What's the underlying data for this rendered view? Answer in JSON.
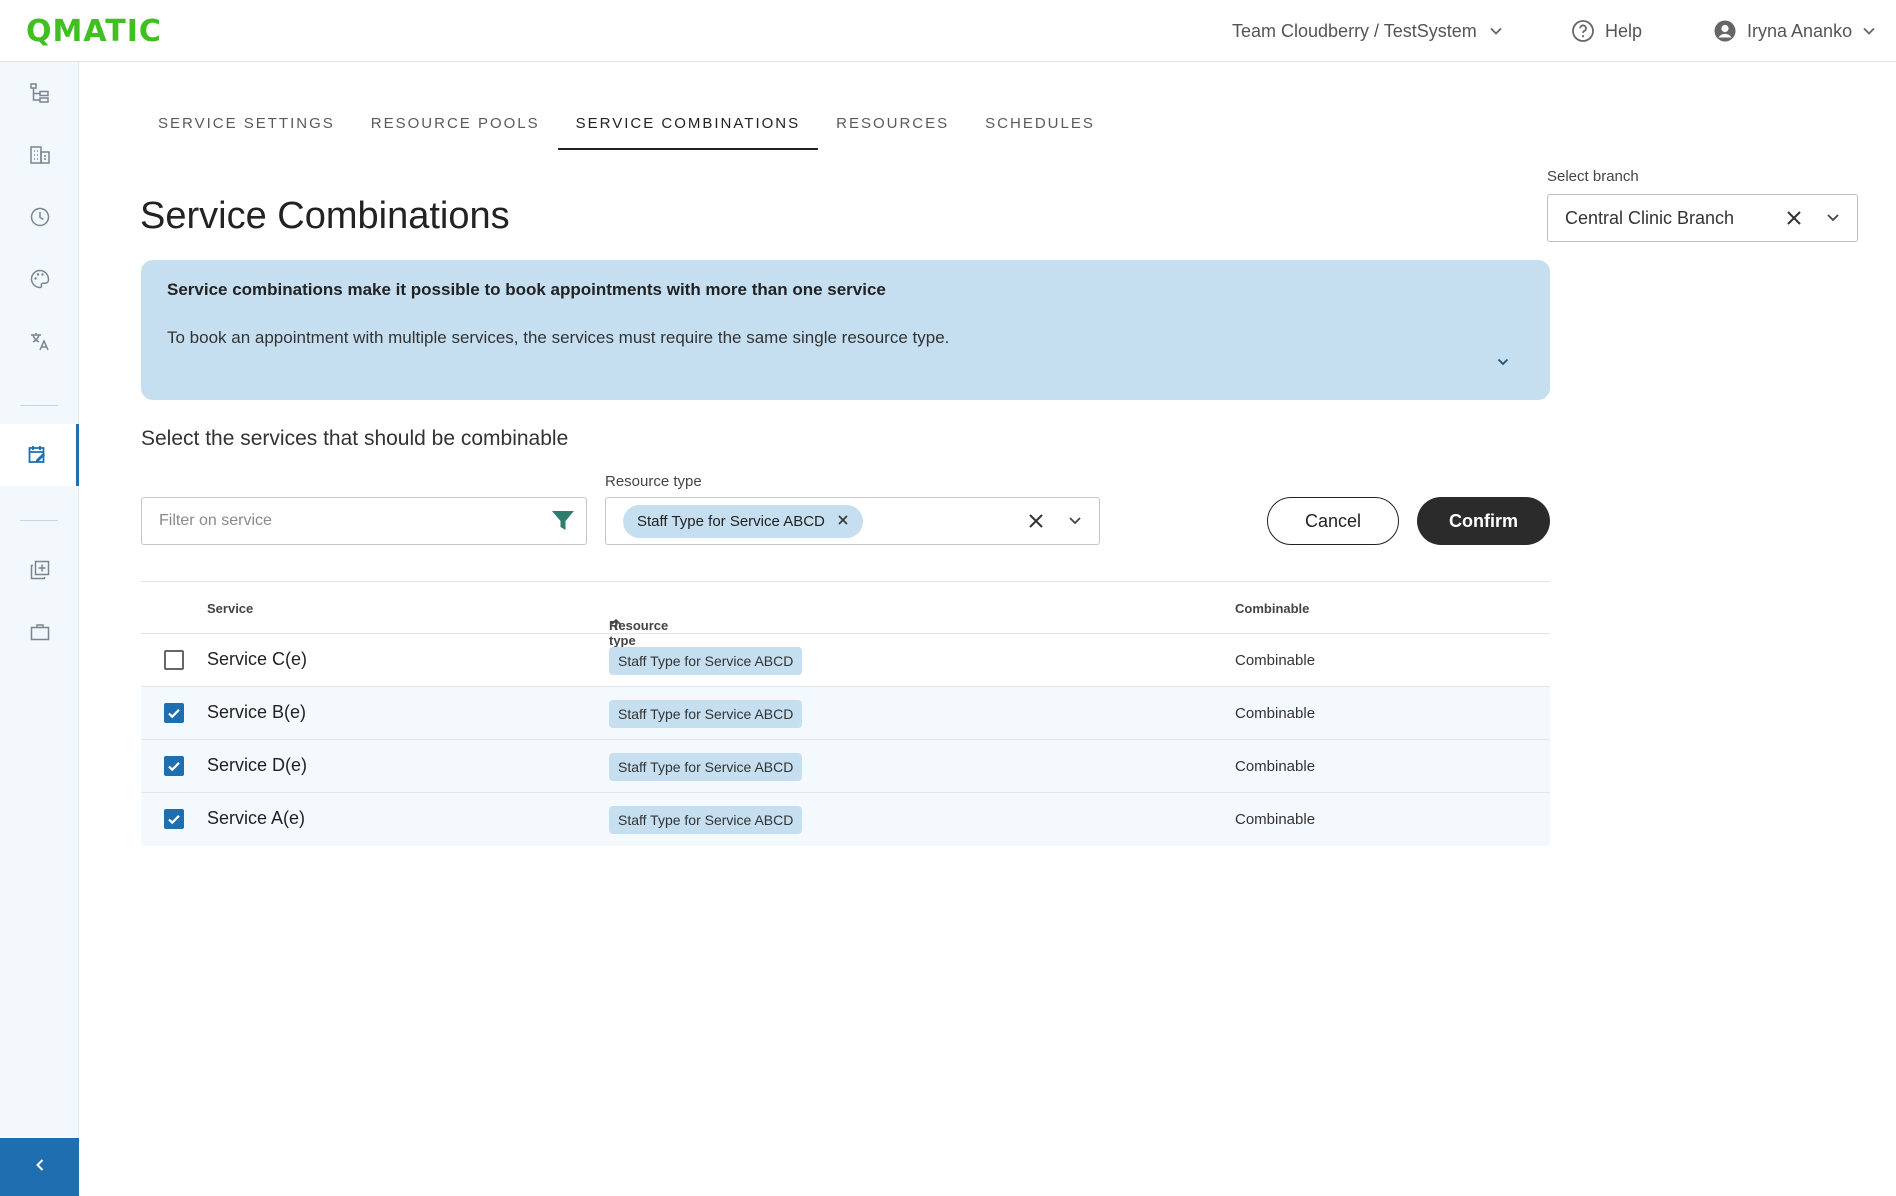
{
  "header": {
    "logo": "QMATIC",
    "team": "Team Cloudberry / TestSystem",
    "help": "Help",
    "user": "Iryna Ananko"
  },
  "sidebar": {
    "icons": [
      "hierarchy-icon",
      "building-icon",
      "clock-icon",
      "palette-icon",
      "translate-icon",
      "calendar-edit-icon",
      "add-copy-icon",
      "briefcase-icon"
    ],
    "active": "calendar-edit-icon"
  },
  "tabs": [
    {
      "label": "SERVICE SETTINGS",
      "active": false
    },
    {
      "label": "RESOURCE POOLS",
      "active": false
    },
    {
      "label": "SERVICE COMBINATIONS",
      "active": true
    },
    {
      "label": "RESOURCES",
      "active": false
    },
    {
      "label": "SCHEDULES",
      "active": false
    }
  ],
  "page": {
    "title": "Service Combinations",
    "branch_label": "Select branch",
    "branch_value": "Central Clinic Branch"
  },
  "info": {
    "title": "Service combinations make it possible to book appointments with more than one service",
    "text": "To book an appointment with multiple services, the services must require the same single resource type."
  },
  "selection": {
    "subtitle": "Select the services that should be combinable",
    "filter_placeholder": "Filter on service",
    "resource_type_label": "Resource type",
    "resource_type_chip": "Staff Type for Service ABCD",
    "cancel": "Cancel",
    "confirm": "Confirm"
  },
  "table": {
    "columns": {
      "service": "Service",
      "resource_type": "Resource type",
      "combinable": "Combinable"
    },
    "rows": [
      {
        "checked": false,
        "service": "Service C(e)",
        "resource_type": "Staff Type for Service ABCD",
        "combinable": "Combinable"
      },
      {
        "checked": true,
        "service": "Service B(e)",
        "resource_type": "Staff Type for Service ABCD",
        "combinable": "Combinable"
      },
      {
        "checked": true,
        "service": "Service D(e)",
        "resource_type": "Staff Type for Service ABCD",
        "combinable": "Combinable"
      },
      {
        "checked": true,
        "service": "Service A(e)",
        "resource_type": "Staff Type for Service ABCD",
        "combinable": "Combinable"
      }
    ]
  },
  "colors": {
    "brand": "#3fbf20",
    "accent": "#1f6fb0",
    "info_bg": "#c6dff0",
    "confirm_bg": "#2b2b2b"
  }
}
